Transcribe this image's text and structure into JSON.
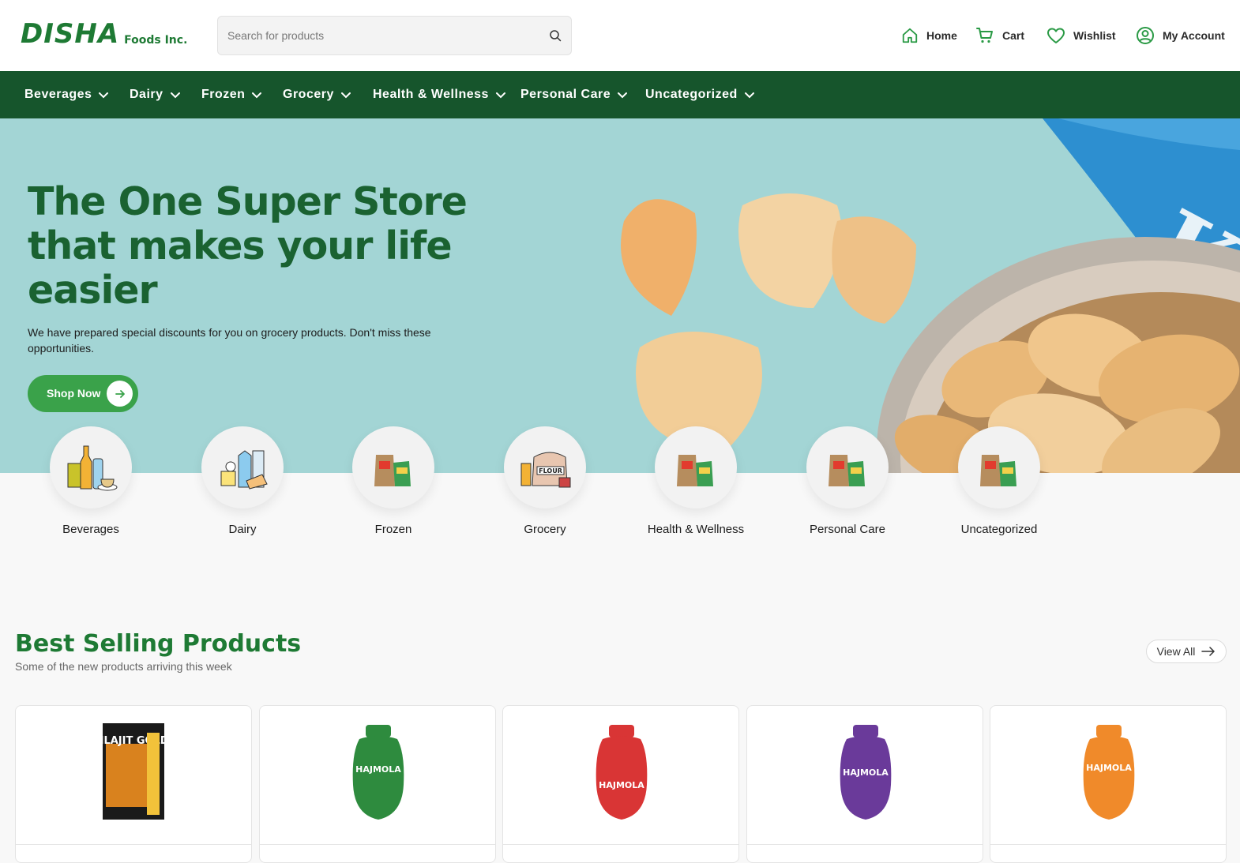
{
  "brand": {
    "name": "DISHA",
    "suffix": "Foods Inc."
  },
  "search": {
    "placeholder": "Search for products"
  },
  "top_nav": [
    {
      "label": "Home",
      "icon": "home-icon"
    },
    {
      "label": "Cart",
      "icon": "cart-icon"
    },
    {
      "label": "Wishlist",
      "icon": "heart-icon"
    },
    {
      "label": "My Account",
      "icon": "user-icon"
    }
  ],
  "categories_menu": [
    "Beverages",
    "Dairy",
    "Frozen",
    "Grocery",
    "Health & Wellness",
    "Personal Care",
    "Uncategorized"
  ],
  "hero": {
    "title": "The One Super Store that makes your life easier",
    "subtitle": "We have prepared special discounts for you on grocery products. Don't miss these opportunities.",
    "cta": "Shop Now"
  },
  "category_tiles": [
    {
      "label": "Beverages",
      "icon": "beverages-icon"
    },
    {
      "label": "Dairy",
      "icon": "dairy-icon"
    },
    {
      "label": "Frozen",
      "icon": "grocery-bag-icon"
    },
    {
      "label": "Grocery",
      "icon": "flour-icon"
    },
    {
      "label": "Health & Wellness",
      "icon": "grocery-bag-icon"
    },
    {
      "label": "Personal Care",
      "icon": "grocery-bag-icon"
    },
    {
      "label": "Uncategorized",
      "icon": "grocery-bag-icon"
    }
  ],
  "best_selling": {
    "title": "Best Selling Products",
    "subtitle": "Some of the new products arriving this week",
    "view_all": "View All",
    "products": [
      {
        "label": "SHILAJIT GOLD",
        "color": "#d9821e"
      },
      {
        "label": "HAJMOLA",
        "color": "#2e8b3e"
      },
      {
        "label": "HAJMOLA",
        "color": "#d93535"
      },
      {
        "label": "HAJMOLA",
        "color": "#6a3a9a"
      },
      {
        "label": "HAJMOLA",
        "color": "#f08a2a"
      }
    ]
  },
  "colors": {
    "brand_green": "#1e7a34",
    "nav_green": "#16552c",
    "cta_green": "#3aa24a",
    "hero_bg": "#a3d5d5"
  }
}
